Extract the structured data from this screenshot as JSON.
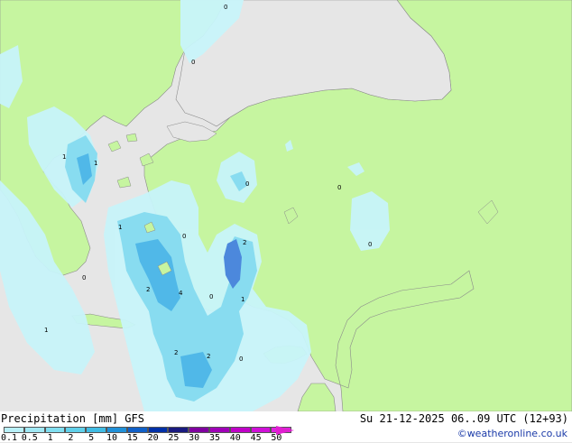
{
  "legend": {
    "title": "Precipitation [mm]  GFS",
    "time": "Su 21-12-2025 06..09 UTC (12+93)",
    "credit": "©weatheronline.co.uk",
    "ticks": [
      "0.1",
      "0.5",
      "1",
      "2",
      "5",
      "10",
      "15",
      "20",
      "25",
      "30",
      "35",
      "40",
      "45",
      "50"
    ],
    "colors": [
      "#b8f0f8",
      "#a0e8f4",
      "#80def0",
      "#60d0ea",
      "#40bce4",
      "#2090d8",
      "#1060c8",
      "#0030a8",
      "#1a1a80",
      "#8000a0",
      "#a000b8",
      "#c000c8",
      "#d010d8",
      "#e020e0"
    ]
  },
  "colors": {
    "land": "#c6f5a0",
    "sea": "#e6e6e6",
    "precip_light": "#c8f4fa",
    "precip_mid": "#88dcf0",
    "precip_heavy": "#50b8e8",
    "precip_core": "#4c88dc"
  },
  "map_labels": [
    {
      "text": "0"
    },
    {
      "text": "0"
    },
    {
      "text": "1"
    },
    {
      "text": "1"
    },
    {
      "text": "0"
    },
    {
      "text": "0"
    },
    {
      "text": "1"
    },
    {
      "text": "0"
    },
    {
      "text": "2"
    },
    {
      "text": "0"
    },
    {
      "text": "0"
    },
    {
      "text": "2"
    },
    {
      "text": "4"
    },
    {
      "text": "0"
    },
    {
      "text": "1"
    },
    {
      "text": "1"
    },
    {
      "text": "2"
    },
    {
      "text": "2"
    },
    {
      "text": "0"
    }
  ]
}
